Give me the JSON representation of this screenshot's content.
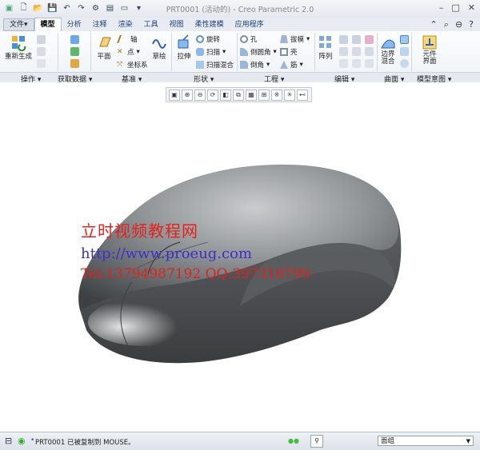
{
  "window": {
    "title": "PRT0001 (活动的) - Creo Parametric 2.0"
  },
  "tabs": [
    {
      "label": "文件",
      "arrow": "▾"
    },
    {
      "label": "模型"
    },
    {
      "label": "分析"
    },
    {
      "label": "注释"
    },
    {
      "label": "渲染"
    },
    {
      "label": "工具"
    },
    {
      "label": "视图"
    },
    {
      "label": "柔性建模"
    },
    {
      "label": "应用程序"
    }
  ],
  "ribbon": {
    "regen": "重新生成",
    "plane": "平面",
    "axis": "轴",
    "point": "点",
    "csys": "坐标系",
    "sketch": "草绘",
    "extrude": "拉伸",
    "revolve": "旋转",
    "sweep": "扫描",
    "helical": "扫描混合",
    "hole": "孔",
    "round": "倒圆角",
    "chamfer": "倒角",
    "draft": "拔模",
    "shell": "壳",
    "rib": "筋",
    "pattern": "阵列",
    "boundary": "边界\n混合",
    "component": "元件\n界面"
  },
  "groups": [
    "操作",
    "获取数据",
    "基准",
    "形状",
    "工程",
    "编辑",
    "曲面",
    "模型意图"
  ],
  "watermark": {
    "line1": "立时视频教程网",
    "line2": "http://www.proeug.com",
    "line3": "Tel:13794987192  QQ:397318799"
  },
  "status": {
    "message": "PRT0001 已被复制到 MOUSE。",
    "filter": "面组"
  }
}
